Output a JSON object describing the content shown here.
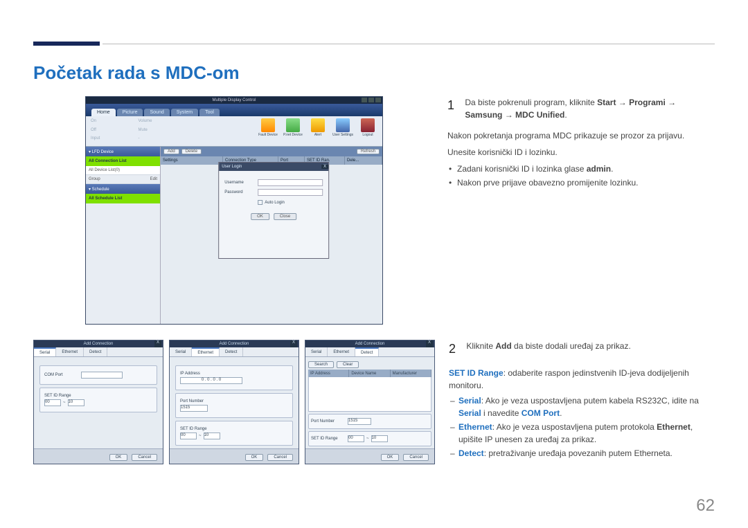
{
  "page": {
    "title": "Početak rada s MDC-om",
    "number": "62"
  },
  "mdc": {
    "window_title": "Multiple Display Control",
    "tabs": [
      "Home",
      "Picture",
      "Sound",
      "System",
      "Tool"
    ],
    "ribbon_left": [
      "On",
      "Volume",
      "Off",
      "Mute",
      "Input",
      "-"
    ],
    "ribbon_icons": {
      "fault": "Fault Device",
      "pdev": "P.net Device",
      "alert": "Alert",
      "users": "User Settings",
      "logout": "Logout"
    },
    "side": {
      "lfd_hdr": "▾ LFD Device",
      "conn_list": "All Connection List",
      "all_list": "All Device List(0)",
      "group_row_l": "Group",
      "group_row_r": "Edit",
      "sched_hdr": "▾ Schedule",
      "sched_list": "All Schedule List"
    },
    "toolbar": {
      "add": "Add",
      "delete": "Delete",
      "refresh": "Refresh"
    },
    "cols": {
      "settings": "Settings",
      "conn_type": "Connection Type",
      "port": "Port",
      "set_id": "SET ID Ran.",
      "dele": "Dele..."
    },
    "login": {
      "title": "User Login",
      "username": "Username",
      "password": "Password",
      "auto": "Auto Login",
      "ok": "OK",
      "close": "Close"
    }
  },
  "addconn": {
    "title": "Add Connection",
    "tabs": {
      "serial": "Serial",
      "ethernet": "Ethernet",
      "detect": "Detect"
    },
    "serial": {
      "com_port": "COM Port",
      "set_id_range": "SET ID Range",
      "range_from": "00",
      "range_to": "10"
    },
    "ethernet": {
      "ip_addr": "IP Address",
      "ip_val": "0 . 0 . 0 . 0",
      "port_num": "Port Number",
      "port_val": "1515",
      "set_id_range": "SET ID Range",
      "range_from": "00",
      "range_to": "10"
    },
    "detect": {
      "search": "Search",
      "clear": "Clear",
      "ip": "IP Address",
      "name": "Device Name",
      "manu": "Manufacturer",
      "port_num": "Port Number",
      "port_val": "1515",
      "set_id_range": "SET ID Range",
      "range_from": "00",
      "range_to": "10"
    },
    "ok": "OK",
    "cancel": "Cancel"
  },
  "instructions": {
    "step1": {
      "num": "1",
      "line1a": "Da biste pokrenuli program, kliknite ",
      "start": "Start",
      "arrow1": " → ",
      "programi": "Programi",
      "arrow2": " → ",
      "samsung": "Samsung",
      "arrow3": " → ",
      "mdc_unified": "MDC Unified",
      "period": ".",
      "post1": "Nakon pokretanja programa MDC prikazuje se prozor za prijavu.",
      "post2": "Unesite korisnički ID i lozinku.",
      "b1a": "Zadani korisnički ID i lozinka glase ",
      "b1b": "admin",
      "b1c": ".",
      "b2": "Nakon prve prijave obavezno promijenite lozinku."
    },
    "step2": {
      "num": "2",
      "line1a": "Kliknite ",
      "add": "Add",
      "line1b": " da biste dodali uređaj za prikaz.",
      "range_lbl": "SET ID Range",
      "range_txt": ": odaberite raspon jedinstvenih ID-jeva dodijeljenih monitoru.",
      "serial_lbl": "Serial",
      "serial_txt_a": ": Ako je veza uspostavljena putem kabela RS232C, idite na ",
      "serial_txt_b": "Serial",
      "serial_txt_c": " i navedite ",
      "com_port": "COM Port",
      "serial_txt_d": ".",
      "eth_lbl": "Ethernet",
      "eth_txt_a": ": Ako je veza uspostavljena putem protokola ",
      "eth_txt_b": "Ethernet",
      "eth_txt_c": ", upišite IP unesen za uređaj za prikaz.",
      "det_lbl": "Detect",
      "det_txt": ": pretraživanje uređaja povezanih putem Etherneta."
    }
  }
}
